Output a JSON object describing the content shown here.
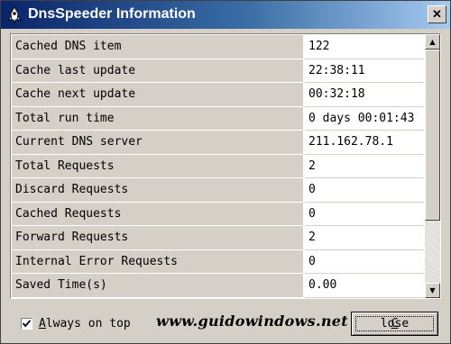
{
  "window": {
    "title": "DnsSpeeder Information",
    "close_glyph": "✕"
  },
  "stats": [
    {
      "label": "Cached DNS item",
      "value": "122"
    },
    {
      "label": "Cache last update",
      "value": "22:38:11"
    },
    {
      "label": "Cache next update",
      "value": "00:32:18"
    },
    {
      "label": "Total run time",
      "value": "0 days 00:01:43"
    },
    {
      "label": "Current DNS server",
      "value": "211.162.78.1"
    },
    {
      "label": "Total Requests",
      "value": "2"
    },
    {
      "label": "Discard Requests",
      "value": "0"
    },
    {
      "label": "Cached Requests",
      "value": "0"
    },
    {
      "label": "Forward Requests",
      "value": "2"
    },
    {
      "label": "Internal Error Requests",
      "value": "0"
    },
    {
      "label": "Saved Time(s)",
      "value": "0.00"
    }
  ],
  "footer": {
    "always_on_top": {
      "mnemonic": "A",
      "rest": "lways on top",
      "checked": true
    },
    "watermark": "www.guidowindows.net",
    "close_button": {
      "mnemonic": "C",
      "rest": "lose"
    }
  },
  "icons": {
    "app": "rocket-icon",
    "scroll_up": "▲",
    "scroll_down": "▼"
  }
}
